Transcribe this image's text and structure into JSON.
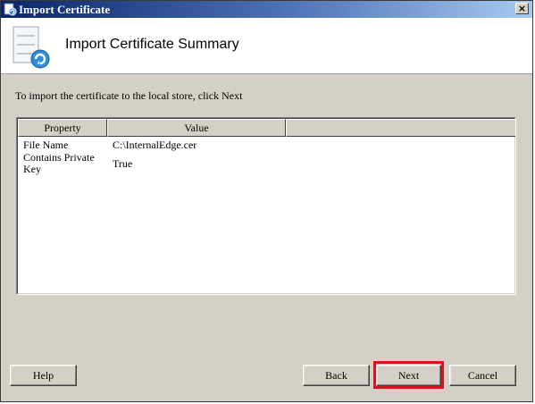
{
  "window": {
    "title": "Import Certificate",
    "close_glyph": "×",
    "icons": {
      "app": "certificate-app-icon",
      "close": "close-icon"
    }
  },
  "header": {
    "title": "Import Certificate Summary",
    "icon": "certificate-import-icon"
  },
  "instruction": "To import the certificate to the local store, click Next",
  "table": {
    "columns": [
      "Property",
      "Value",
      ""
    ],
    "rows": [
      {
        "property": "File Name",
        "value": "C:\\InternalEdge.cer"
      },
      {
        "property": "Contains Private Key",
        "value": "True"
      }
    ]
  },
  "buttons": {
    "help": "Help",
    "back": "Back",
    "next": "Next",
    "cancel": "Cancel"
  },
  "colors": {
    "titlebar_start": "#0a246a",
    "titlebar_end": "#a6caf0",
    "dialog_bg": "#d4d0c8",
    "highlight": "#d6141e"
  }
}
